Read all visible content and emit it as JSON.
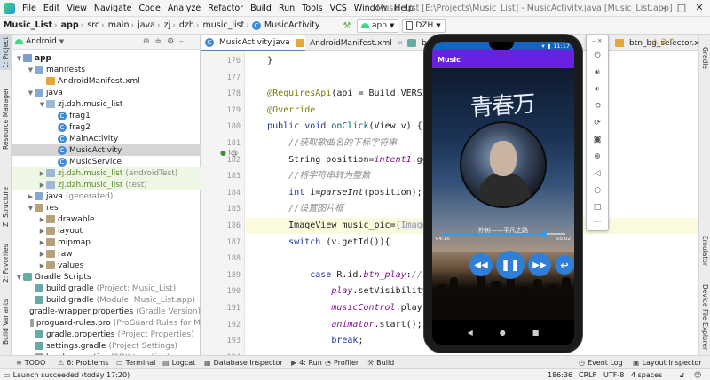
{
  "menubar": {
    "items": [
      "File",
      "Edit",
      "View",
      "Navigate",
      "Code",
      "Analyze",
      "Refactor",
      "Build",
      "Run",
      "Tools",
      "VCS",
      "Window",
      "Help"
    ],
    "title": "Music_List [E:\\Projects\\Music_List] - MusicActivity.java [Music_List.app]"
  },
  "breadcrumb": [
    "Music_List",
    "app",
    "src",
    "main",
    "java",
    "zj",
    "dzh",
    "music_list",
    "MusicActivity"
  ],
  "run_config": "app",
  "device": "DZH",
  "left_tabs": [
    "1: Project",
    "Resource Manager",
    "Z: Structure",
    "2: Favorites",
    "Build Variants"
  ],
  "right_tabs": [
    "Gradle",
    "Emulator",
    "Device File Explorer"
  ],
  "project": {
    "view": "Android",
    "tree": [
      {
        "label": "app",
        "indent": 0,
        "arrow": "open",
        "icon": "app-folder",
        "bold": true
      },
      {
        "label": "manifests",
        "indent": 1,
        "arrow": "open",
        "icon": "folder"
      },
      {
        "label": "AndroidManifest.xml",
        "indent": 2,
        "arrow": "",
        "icon": "xml"
      },
      {
        "label": "java",
        "indent": 1,
        "arrow": "open",
        "icon": "folder"
      },
      {
        "label": "zj.dzh.music_list",
        "indent": 2,
        "arrow": "open",
        "icon": "pkg"
      },
      {
        "label": "frag1",
        "indent": 3,
        "arrow": "",
        "icon": "class"
      },
      {
        "label": "frag2",
        "indent": 3,
        "arrow": "",
        "icon": "class"
      },
      {
        "label": "MainActivity",
        "indent": 3,
        "arrow": "",
        "icon": "class"
      },
      {
        "label": "MusicActivity",
        "indent": 3,
        "arrow": "",
        "icon": "class",
        "selected": true
      },
      {
        "label": "MusicService",
        "indent": 3,
        "arrow": "",
        "icon": "class"
      },
      {
        "label": "zj.dzh.music_list",
        "note": "(androidTest)",
        "indent": 2,
        "arrow": "closed",
        "icon": "pkg",
        "test": true
      },
      {
        "label": "zj.dzh.music_list",
        "note": "(test)",
        "indent": 2,
        "arrow": "closed",
        "icon": "pkg",
        "test": true
      },
      {
        "label": "java",
        "note": "(generated)",
        "indent": 1,
        "arrow": "closed",
        "icon": "folder"
      },
      {
        "label": "res",
        "indent": 1,
        "arrow": "open",
        "icon": "res-folder"
      },
      {
        "label": "drawable",
        "indent": 2,
        "arrow": "closed",
        "icon": "res-folder"
      },
      {
        "label": "layout",
        "indent": 2,
        "arrow": "closed",
        "icon": "res-folder"
      },
      {
        "label": "mipmap",
        "indent": 2,
        "arrow": "closed",
        "icon": "res-folder"
      },
      {
        "label": "raw",
        "indent": 2,
        "arrow": "closed",
        "icon": "res-folder"
      },
      {
        "label": "values",
        "indent": 2,
        "arrow": "closed",
        "icon": "res-folder"
      },
      {
        "label": "Gradle Scripts",
        "indent": 0,
        "arrow": "open",
        "icon": "gradle"
      },
      {
        "label": "build.gradle",
        "note": "(Project: Music_List)",
        "indent": 1,
        "arrow": "",
        "icon": "gradle"
      },
      {
        "label": "build.gradle",
        "note": "(Module: Music_List.app)",
        "indent": 1,
        "arrow": "",
        "icon": "gradle"
      },
      {
        "label": "gradle-wrapper.properties",
        "note": "(Gradle Version)",
        "indent": 1,
        "arrow": "",
        "icon": "prop"
      },
      {
        "label": "proguard-rules.pro",
        "note": "(ProGuard Rules for M",
        "indent": 1,
        "arrow": "",
        "icon": "prop"
      },
      {
        "label": "gradle.properties",
        "note": "(Project Properties)",
        "indent": 1,
        "arrow": "",
        "icon": "gradle"
      },
      {
        "label": "settings.gradle",
        "note": "(Project Settings)",
        "indent": 1,
        "arrow": "",
        "icon": "gradle"
      },
      {
        "label": "local.properties",
        "note": "(SDK Location)",
        "indent": 1,
        "arrow": "",
        "icon": "prop"
      }
    ]
  },
  "editor": {
    "tabs": [
      {
        "label": "MusicActivity.java",
        "icon": "class",
        "active": true
      },
      {
        "label": "AndroidManifest.xml",
        "icon": "xml"
      },
      {
        "label": "build.g",
        "icon": "gradle"
      },
      {
        "label": "btn_bg_selector.xml",
        "icon": "xml"
      }
    ],
    "warnings": "2",
    "lines": [
      {
        "num": "176",
        "html": "    }"
      },
      {
        "num": "177",
        "html": ""
      },
      {
        "num": "178",
        "html": "    <span class='an'>@RequiresApi</span>(api = Build.VERSI"
      },
      {
        "num": "179",
        "html": "    <span class='an'>@Override</span>"
      },
      {
        "num": "180",
        "html": "    <span class='kw'>public void</span> <span class='mt'>onClick</span>(View v) {"
      },
      {
        "num": "181",
        "html": "        <span class='cm'>//获取歌曲名的下标字符串</span>"
      },
      {
        "num": "182",
        "html": "        String position=<span class='fd'>intent1</span>.ge"
      },
      {
        "num": "183",
        "html": "        <span class='cm'>//将字符串转为整数</span>"
      },
      {
        "num": "184",
        "html": "        <span class='kw'>int</span> i=<span class='it'>parseInt</span>(position);"
      },
      {
        "num": "185",
        "html": "        <span class='cm'>//设置图片框</span>"
      },
      {
        "num": "186",
        "html": "        ImageView music_pic=(<span class='hint'>Image</span>",
        "hl": true
      },
      {
        "num": "187",
        "html": "        <span class='kw'>switch</span> (v.getId()){"
      },
      {
        "num": "188",
        "html": ""
      },
      {
        "num": "189",
        "html": "            <span class='kw'>case</span> R.id.<span class='fd'>btn_play</span>:<span class='cm'>//播</span>"
      },
      {
        "num": "190",
        "html": "                <span class='fd'>play</span>.setVisibility"
      },
      {
        "num": "191",
        "html": "                <span class='fd'>musicControl</span>.play("
      },
      {
        "num": "192",
        "html": "                <span class='fd'>animator</span>.start();"
      },
      {
        "num": "193",
        "html": "                <span class='kw'>break</span>;"
      },
      {
        "num": "194",
        "html": ""
      },
      {
        "num": "195",
        "html": "            <span class='kw'>case</span> R.id.<span class='fd'>btn_pre</span>:<span class='cm'>//播</span>"
      }
    ]
  },
  "emulator": {
    "status_time": "11:17",
    "app_title": "Music",
    "art_title": "青春万岁",
    "song": "朴树——平凡之路",
    "time_current": "04:10",
    "time_total": "05:02",
    "progress": 0.83
  },
  "bottom_tools": [
    {
      "label": "TODO",
      "icon": "≡"
    },
    {
      "label": "6: Problems",
      "icon": "⚠"
    },
    {
      "label": "Terminal",
      "icon": "▭"
    },
    {
      "label": "Logcat",
      "icon": "▤"
    },
    {
      "label": "Database Inspector",
      "icon": "▦"
    },
    {
      "label": "4: Run",
      "icon": "▶"
    },
    {
      "label": "Profiler",
      "icon": "◔"
    },
    {
      "label": "Build",
      "icon": "⚒"
    },
    {
      "label": "Event Log",
      "icon": "◷"
    },
    {
      "label": "Layout Inspector",
      "icon": "▣"
    }
  ],
  "statusbar": {
    "message": "Launch succeeded (today 17:20)",
    "position": "186:36",
    "line_sep": "CRLF",
    "encoding": "UTF-8",
    "indent": "4 spaces"
  }
}
